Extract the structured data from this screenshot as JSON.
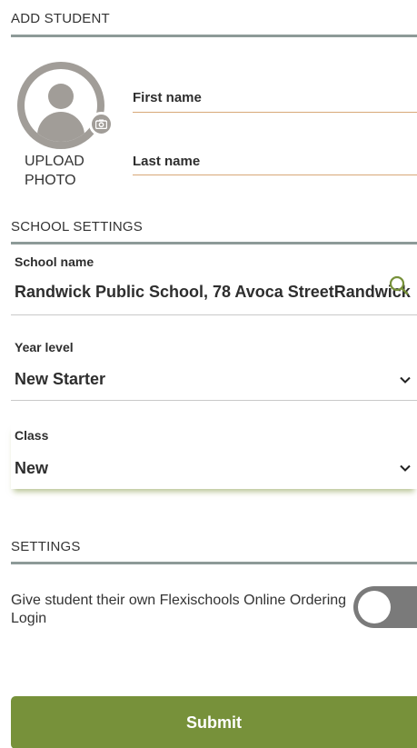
{
  "header": {
    "title": "ADD STUDENT"
  },
  "photo": {
    "upload_label": "UPLOAD PHOTO",
    "icon": "user-avatar-icon",
    "camera_icon": "camera-icon"
  },
  "student": {
    "first_name_label": "First name",
    "last_name_label": "Last name"
  },
  "school_settings": {
    "title": "SCHOOL SETTINGS",
    "school_name_label": "School name",
    "school_name_value": "Randwick Public School, 78 Avoca StreetRandwick",
    "year_level_label": "Year level",
    "year_level_value": "New Starter",
    "class_label": "Class",
    "class_value": "New"
  },
  "settings": {
    "title": "SETTINGS",
    "login_toggle_label": "Give student their own Flexischools Online Ordering Login",
    "login_toggle_on": false
  },
  "actions": {
    "submit_label": "Submit"
  },
  "colors": {
    "accent_green": "#77913a",
    "rule_grey": "#8d9a98",
    "name_underline": "#d8a878",
    "toggle_off": "#7a7a7a"
  }
}
